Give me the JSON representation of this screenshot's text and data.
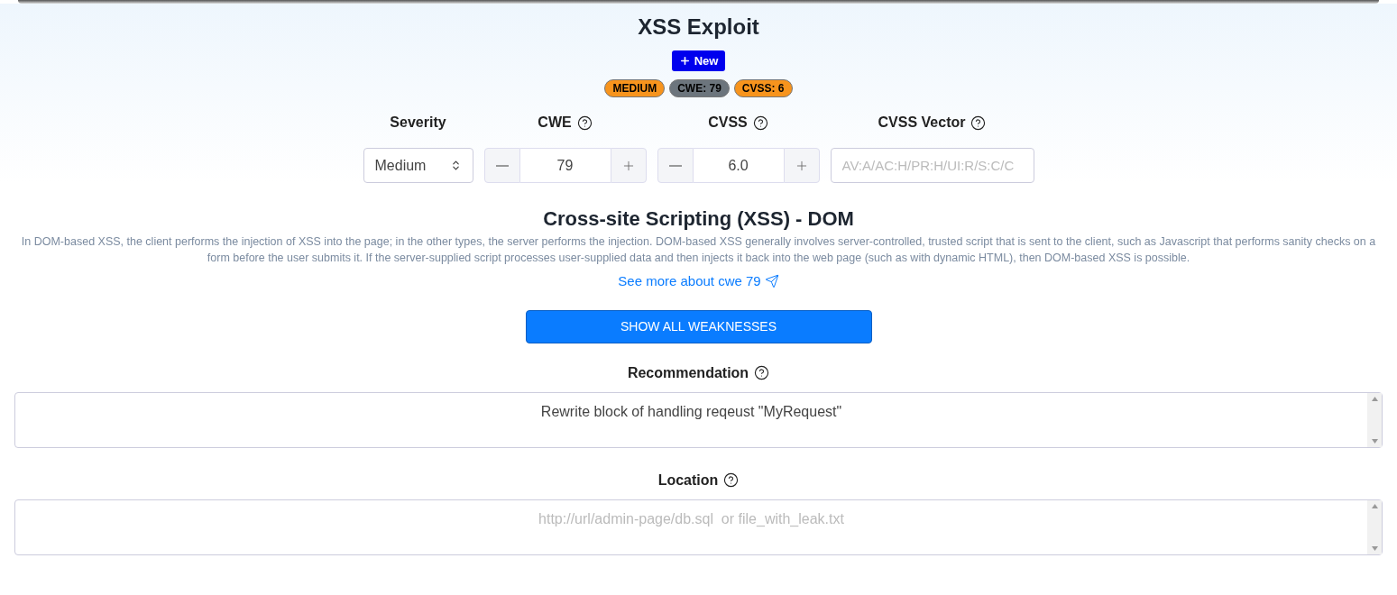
{
  "title": "XSS Exploit",
  "new_button": {
    "label": "New"
  },
  "badges": [
    {
      "label": "MEDIUM",
      "color": "#f7941d"
    },
    {
      "label": "CWE: 79",
      "color": "#6c757d"
    },
    {
      "label": "CVSS: 6",
      "color": "#f7941d"
    }
  ],
  "fields": [
    {
      "kind": "select",
      "label": "Severity",
      "help": false,
      "value": "Medium"
    },
    {
      "kind": "stepper",
      "label": "CWE",
      "help": true,
      "value": "79"
    },
    {
      "kind": "stepper",
      "label": "CVSS",
      "help": true,
      "value": "6.0"
    },
    {
      "kind": "text",
      "label": "CVSS Vector",
      "help": true,
      "placeholder": "AV:A/AC:H/PR:H/UI:R/S:C/C"
    }
  ],
  "weakness": {
    "title": "Cross-site Scripting (XSS) - DOM",
    "description": "In DOM-based XSS, the client performs the injection of XSS into the page; in the other types, the server performs the injection. DOM-based XSS generally involves server-controlled, trusted script that is sent to the client, such as Javascript that performs sanity checks on a form before the user submits it. If the server-supplied script processes user-supplied data and then injects it back into the web page (such as with dynamic HTML), then DOM-based XSS is possible.",
    "link": "See more about cwe 79"
  },
  "show_all_button": {
    "label": "SHOW ALL WEAKNESSES"
  },
  "text_areas": [
    {
      "label": "Recommendation",
      "value": "Rewrite block of handling reqeust \"MyRequest\""
    },
    {
      "label": "Location",
      "placeholder": "http://url/admin-page/db.sql  or file_with_leak.txt"
    }
  ]
}
